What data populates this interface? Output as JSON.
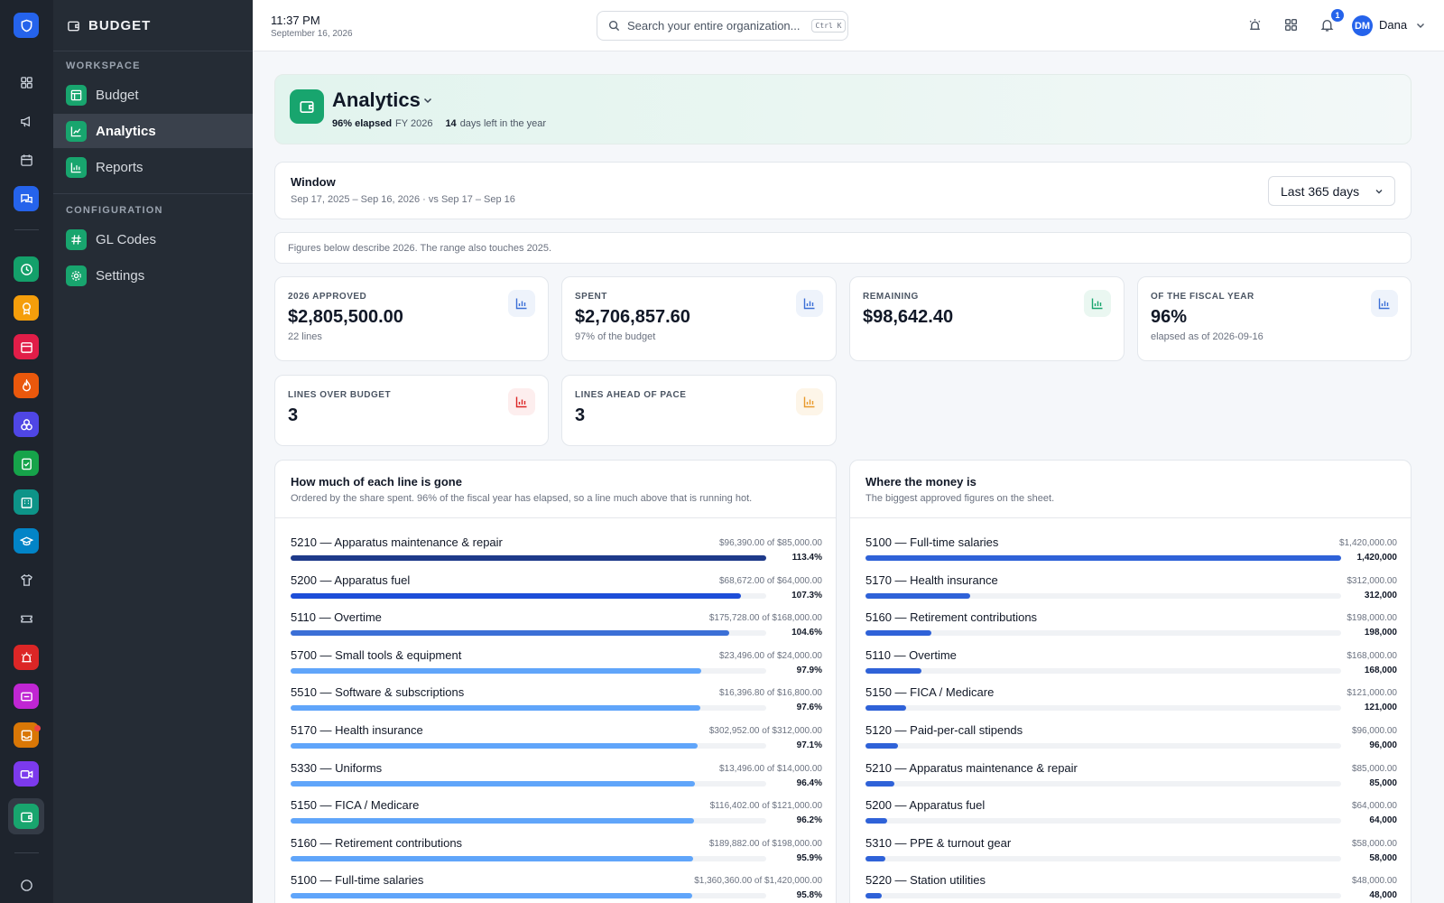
{
  "app": {
    "section_title": "BUDGET"
  },
  "sidebar": {
    "workspace_label": "WORKSPACE",
    "config_label": "CONFIGURATION",
    "items": [
      {
        "label": "Budget",
        "icon": "table-icon"
      },
      {
        "label": "Analytics",
        "icon": "line-chart-icon",
        "active": true
      },
      {
        "label": "Reports",
        "icon": "bar-chart-icon"
      },
      {
        "label": "GL Codes",
        "icon": "hash-icon"
      },
      {
        "label": "Settings",
        "icon": "gear-icon"
      }
    ]
  },
  "topbar": {
    "time": "11:37 PM",
    "date": "September 16, 2026",
    "search_placeholder": "Search your entire organization...",
    "shortcut": "Ctrl K",
    "notification_count": "1",
    "avatar_initials": "DM",
    "user_name": "Dana"
  },
  "hero": {
    "title": "Analytics",
    "elapsed": "96% elapsed",
    "fiscal_year": "FY 2026",
    "days_left_num": "14",
    "days_left_text": "days left in the year"
  },
  "window": {
    "title": "Window",
    "range": "Sep 17, 2025 – Sep 16, 2026 · vs Sep 17 – Sep 16",
    "select_value": "Last 365 days"
  },
  "note": "Figures below describe 2026. The range also touches 2025.",
  "kpis": [
    {
      "label": "2026 APPROVED",
      "value": "$2,805,500.00",
      "sub": "22 lines",
      "icon_bg": "#eef3fb",
      "icon_color": "#3b6fd6"
    },
    {
      "label": "SPENT",
      "value": "$2,706,857.60",
      "sub": "97% of the budget",
      "icon_bg": "#eef3fb",
      "icon_color": "#3b6fd6"
    },
    {
      "label": "REMAINING",
      "value": "$98,642.40",
      "sub": "",
      "icon_bg": "#eaf7f1",
      "icon_color": "#18a56e"
    },
    {
      "label": "OF THE FISCAL YEAR",
      "value": "96%",
      "sub": "elapsed as of 2026-09-16",
      "icon_bg": "#eef3fb",
      "icon_color": "#3b6fd6"
    },
    {
      "label": "LINES OVER BUDGET",
      "value": "3",
      "sub": "",
      "icon_bg": "#fdeeee",
      "icon_color": "#dc2626"
    },
    {
      "label": "LINES AHEAD OF PACE",
      "value": "3",
      "sub": "",
      "icon_bg": "#fdf5e8",
      "icon_color": "#e89a2c"
    }
  ],
  "panel_spent": {
    "title": "How much of each line is gone",
    "subtitle": "Ordered by the share spent. 96% of the fiscal year has elapsed, so a line much above that is running hot.",
    "rows": [
      {
        "label": "5210 — Apparatus maintenance & repair",
        "amount": "$96,390.00 of $85,000.00",
        "pct": "113.4%",
        "fraction": 1.0,
        "color": "#1e3a8a"
      },
      {
        "label": "5200 — Apparatus fuel",
        "amount": "$68,672.00 of $64,000.00",
        "pct": "107.3%",
        "fraction": 0.946,
        "color": "#1d4ed8"
      },
      {
        "label": "5110 — Overtime",
        "amount": "$175,728.00 of $168,000.00",
        "pct": "104.6%",
        "fraction": 0.922,
        "color": "#3b6fd6"
      },
      {
        "label": "5700 — Small tools & equipment",
        "amount": "$23,496.00 of $24,000.00",
        "pct": "97.9%",
        "fraction": 0.863,
        "color": "#60a5fa"
      },
      {
        "label": "5510 — Software & subscriptions",
        "amount": "$16,396.80 of $16,800.00",
        "pct": "97.6%",
        "fraction": 0.861,
        "color": "#60a5fa"
      },
      {
        "label": "5170 — Health insurance",
        "amount": "$302,952.00 of $312,000.00",
        "pct": "97.1%",
        "fraction": 0.856,
        "color": "#60a5fa"
      },
      {
        "label": "5330 — Uniforms",
        "amount": "$13,496.00 of $14,000.00",
        "pct": "96.4%",
        "fraction": 0.85,
        "color": "#60a5fa"
      },
      {
        "label": "5150 — FICA / Medicare",
        "amount": "$116,402.00 of $121,000.00",
        "pct": "96.2%",
        "fraction": 0.848,
        "color": "#60a5fa"
      },
      {
        "label": "5160 — Retirement contributions",
        "amount": "$189,882.00 of $198,000.00",
        "pct": "95.9%",
        "fraction": 0.846,
        "color": "#60a5fa"
      },
      {
        "label": "5100 — Full-time salaries",
        "amount": "$1,360,360.00 of $1,420,000.00",
        "pct": "95.8%",
        "fraction": 0.845,
        "color": "#60a5fa"
      }
    ]
  },
  "panel_money": {
    "title": "Where the money is",
    "subtitle": "The biggest approved figures on the sheet.",
    "rows": [
      {
        "label": "5100 — Full-time salaries",
        "amount": "$1,420,000.00",
        "value": "1,420,000",
        "fraction": 1.0,
        "color": "#2f62d8"
      },
      {
        "label": "5170 — Health insurance",
        "amount": "$312,000.00",
        "value": "312,000",
        "fraction": 0.22,
        "color": "#2f62d8"
      },
      {
        "label": "5160 — Retirement contributions",
        "amount": "$198,000.00",
        "value": "198,000",
        "fraction": 0.139,
        "color": "#2f62d8"
      },
      {
        "label": "5110 — Overtime",
        "amount": "$168,000.00",
        "value": "168,000",
        "fraction": 0.118,
        "color": "#2f62d8"
      },
      {
        "label": "5150 — FICA / Medicare",
        "amount": "$121,000.00",
        "value": "121,000",
        "fraction": 0.085,
        "color": "#2f62d8"
      },
      {
        "label": "5120 — Paid-per-call stipends",
        "amount": "$96,000.00",
        "value": "96,000",
        "fraction": 0.068,
        "color": "#2f62d8"
      },
      {
        "label": "5210 — Apparatus maintenance & repair",
        "amount": "$85,000.00",
        "value": "85,000",
        "fraction": 0.06,
        "color": "#2f62d8"
      },
      {
        "label": "5200 — Apparatus fuel",
        "amount": "$64,000.00",
        "value": "64,000",
        "fraction": 0.045,
        "color": "#2f62d8"
      },
      {
        "label": "5310 — PPE & turnout gear",
        "amount": "$58,000.00",
        "value": "58,000",
        "fraction": 0.041,
        "color": "#2f62d8"
      },
      {
        "label": "5220 — Station utilities",
        "amount": "$48,000.00",
        "value": "48,000",
        "fraction": 0.034,
        "color": "#2f62d8"
      }
    ]
  },
  "rail": {
    "colors": [
      "#2563eb",
      "#2a313b",
      "#2a313b",
      "#2a313b",
      "#2563eb",
      "#14a06a",
      "#f59e0b",
      "#e11d48",
      "#ea580c",
      "#4f46e5",
      "#16a34a",
      "#0d9488",
      "#0284c7",
      "#2a313b",
      "#2a313b",
      "#dc2626",
      "#c026d3",
      "#d97706",
      "#7c3aed",
      "#18a56e"
    ]
  }
}
